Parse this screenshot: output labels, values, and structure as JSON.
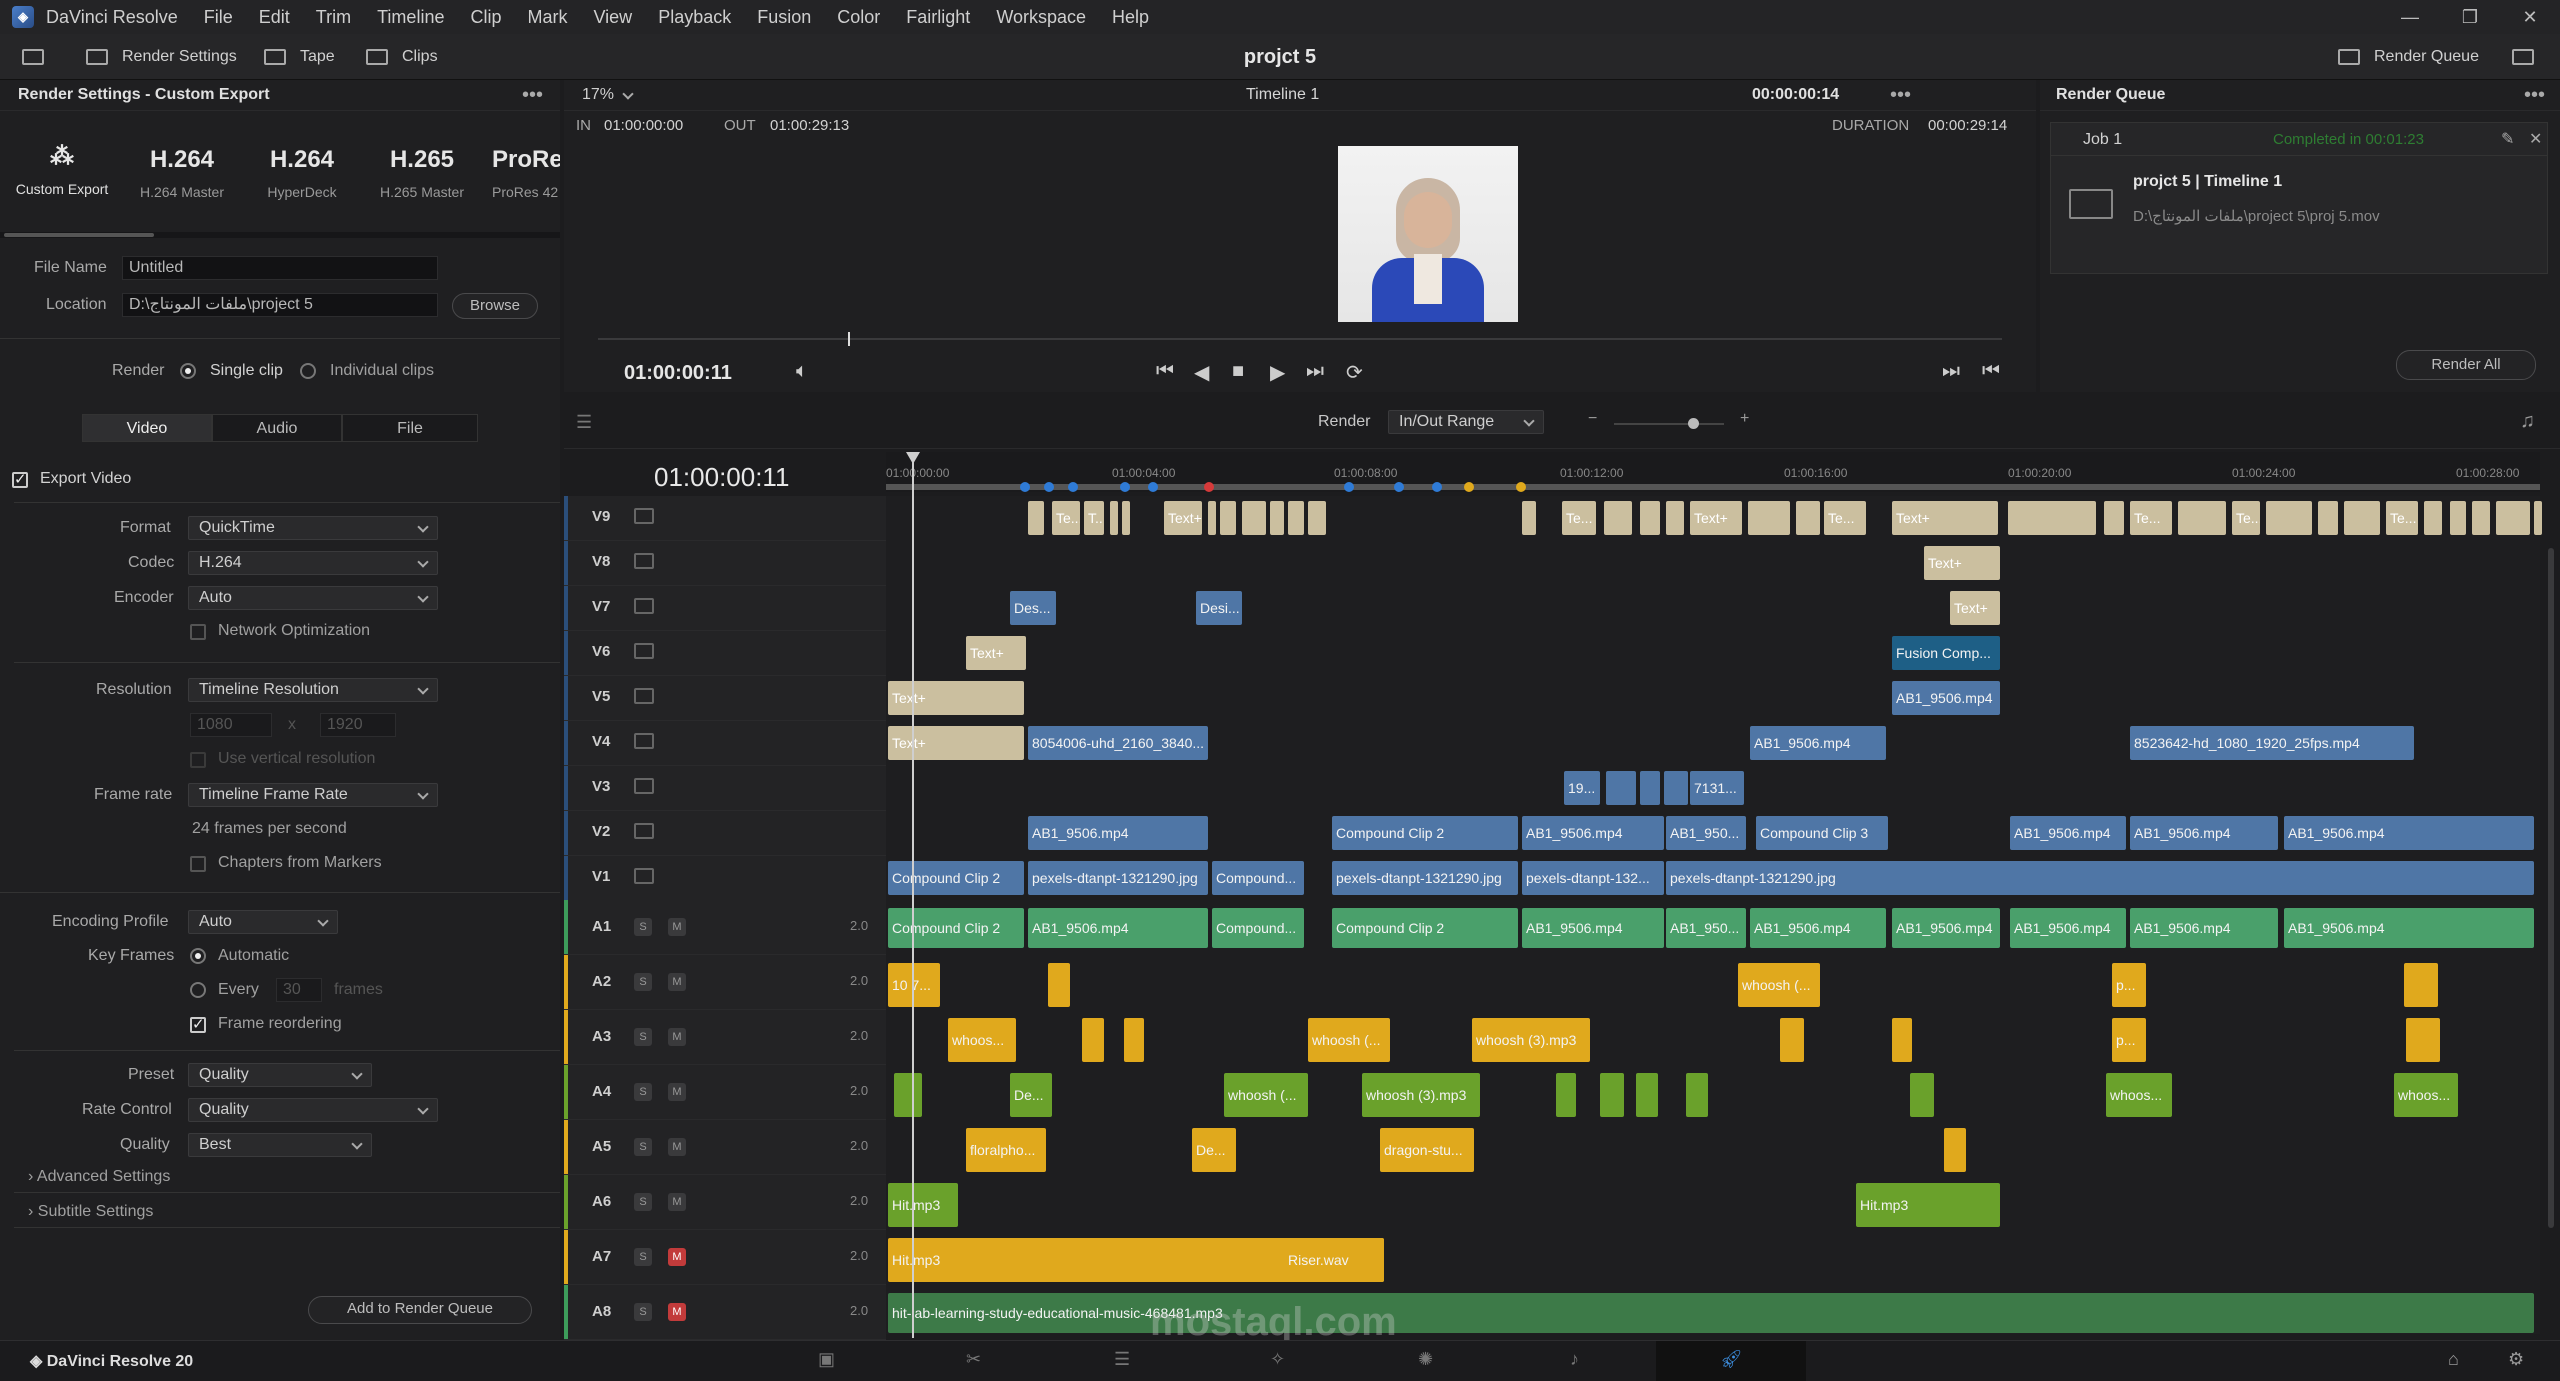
{
  "menubar": {
    "app_name": "DaVinci Resolve",
    "items": [
      "File",
      "Edit",
      "Trim",
      "Timeline",
      "Clip",
      "Mark",
      "View",
      "Playback",
      "Fusion",
      "Color",
      "Fairlight",
      "Workspace",
      "Help"
    ]
  },
  "toolbar": {
    "render_settings": "Render Settings",
    "tape": "Tape",
    "clips": "Clips",
    "project_title": "projct 5",
    "render_queue": "Render Queue"
  },
  "render_settings": {
    "title": "Render Settings - Custom Export",
    "presets": [
      {
        "big": "",
        "label": "Custom Export"
      },
      {
        "big": "H.264",
        "label": "H.264 Master"
      },
      {
        "big": "H.264",
        "label": "HyperDeck"
      },
      {
        "big": "H.265",
        "label": "H.265 Master"
      },
      {
        "big": "ProRe",
        "label": "ProRes 42"
      }
    ],
    "file_name_label": "File Name",
    "file_name_value": "Untitled",
    "location_label": "Location",
    "location_value": "D:\\ملفات المونتاج\\project 5",
    "browse": "Browse",
    "render_label": "Render",
    "single_clip": "Single clip",
    "individual_clips": "Individual clips",
    "tabs": [
      "Video",
      "Audio",
      "File"
    ],
    "export_video": "Export Video",
    "format_label": "Format",
    "format_value": "QuickTime",
    "codec_label": "Codec",
    "codec_value": "H.264",
    "encoder_label": "Encoder",
    "encoder_value": "Auto",
    "network_opt": "Network Optimization",
    "resolution_label": "Resolution",
    "resolution_value": "Timeline Resolution",
    "res_w": "1080",
    "res_x": "x",
    "res_h": "1920",
    "use_vertical": "Use vertical resolution",
    "frame_rate_label": "Frame rate",
    "frame_rate_value": "Timeline Frame Rate",
    "fps_text": "24 frames per second",
    "chapters": "Chapters from Markers",
    "encoding_profile_label": "Encoding Profile",
    "encoding_profile_value": "Auto",
    "key_frames_label": "Key Frames",
    "automatic": "Automatic",
    "every": "Every",
    "every_value": "30",
    "frames": "frames",
    "frame_reordering": "Frame reordering",
    "preset_label": "Preset",
    "preset_value": "Quality",
    "rate_control_label": "Rate Control",
    "rate_control_value": "Quality",
    "quality_label": "Quality",
    "quality_value": "Best",
    "advanced": "Advanced Settings",
    "subtitle": "Subtitle Settings",
    "add_to_queue": "Add to Render Queue"
  },
  "viewer": {
    "zoom": "17%",
    "timeline_name": "Timeline 1",
    "timecode_top": "00:00:00:14",
    "in_label": "IN",
    "in_value": "01:00:00:00",
    "out_label": "OUT",
    "out_value": "01:00:29:13",
    "duration_label": "DURATION",
    "duration_value": "00:00:29:14",
    "current_tc": "01:00:00:11"
  },
  "render_queue": {
    "title": "Render Queue",
    "job": "Job 1",
    "status": "Completed in 00:01:23",
    "job_title": "projct 5 | Timeline 1",
    "job_path": "D:\\ملفات المونتاج\\project 5\\proj 5.mov",
    "render_all": "Render All"
  },
  "timeline": {
    "render_label": "Render",
    "render_range": "In/Out Range",
    "timecode": "01:00:00:11",
    "ruler": [
      "01:00:00:00",
      "01:00:04:00",
      "01:00:08:00",
      "01:00:12:00",
      "01:00:16:00",
      "01:00:20:00",
      "01:00:24:00",
      "01:00:28:00"
    ],
    "video_tracks": [
      "V9",
      "V8",
      "V7",
      "V6",
      "V5",
      "V4",
      "V3",
      "V2",
      "V1"
    ],
    "audio_tracks": [
      {
        "name": "A1",
        "level": "2.0"
      },
      {
        "name": "A2",
        "level": "2.0"
      },
      {
        "name": "A3",
        "level": "2.0"
      },
      {
        "name": "A4",
        "level": "2.0"
      },
      {
        "name": "A5",
        "level": "2.0"
      },
      {
        "name": "A6",
        "level": "2.0"
      },
      {
        "name": "A7",
        "level": "2.0"
      },
      {
        "name": "A8",
        "level": "2.0"
      }
    ],
    "s_label": "S",
    "m_label": "M"
  },
  "clips": {
    "v9": [
      "Te...",
      "T...",
      "Text+",
      "Te...",
      "Text+",
      "Te...",
      "Text+",
      "Te...",
      "Te...",
      "Te...",
      "Text+"
    ],
    "v8": "Text+",
    "v7": [
      "Des...",
      "Desi...",
      "Text+"
    ],
    "v6": [
      "Text+",
      "Fusion Comp..."
    ],
    "v5": [
      "Text+",
      "AB1_9506.mp4"
    ],
    "v4": [
      "Text+",
      "8054006-uhd_2160_3840...",
      "AB1_9506.mp4",
      "8523642-hd_1080_1920_25fps.mp4"
    ],
    "v3": [
      "19...",
      "7131..."
    ],
    "v2": [
      "AB1_9506.mp4",
      "Compound Clip 2",
      "AB1_9506.mp4",
      "AB1_950...",
      "Compound Clip 3",
      "AB1_9506.mp4",
      "AB1_9506.mp4",
      "AB1_9506.mp4"
    ],
    "v1": [
      "Compound Clip 2",
      "pexels-dtanpt-1321290.jpg",
      "Compound...",
      "pexels-dtanpt-1321290.jpg",
      "pexels-dtanpt-132...",
      "pexels-dtanpt-1321290.jpg"
    ],
    "a1": [
      "Compound Clip 2",
      "AB1_9506.mp4",
      "Compound...",
      "Compound Clip 2",
      "AB1_9506.mp4",
      "AB1_950...",
      "AB1_9506.mp4",
      "AB1_9506.mp4",
      "AB1_9506.mp4",
      "AB1_9506.mp4",
      "AB1_9506.mp4"
    ],
    "a2": [
      "10 7...",
      "whoosh (...",
      "p..."
    ],
    "a3": [
      "whoos...",
      "whoosh (...",
      "whoosh (3).mp3",
      "p..."
    ],
    "a4": [
      "De...",
      "whoosh (...",
      "whoosh (3).mp3",
      "whoos...",
      "whoos..."
    ],
    "a5": [
      "floralpho...",
      "De...",
      "dragon-stu..."
    ],
    "a6": [
      "Hit.mp3",
      "Hit.mp3"
    ],
    "a7": [
      "Hit.mp3",
      "Riser.wav"
    ],
    "a8": "hit-lab-learning-study-educational-music-468481.mp3"
  },
  "bottom": {
    "product": "DaVinci Resolve 20"
  },
  "watermark": {
    "text": "mostaql.com"
  },
  "colors": {
    "text_clip": "#cbbf9f",
    "video_clip": "#4f76a6",
    "audio_main": "#4aa06b",
    "audio_yellow": "#e0a91d",
    "audio_green": "#6aa12b",
    "playhead": "#e0e0e0"
  }
}
